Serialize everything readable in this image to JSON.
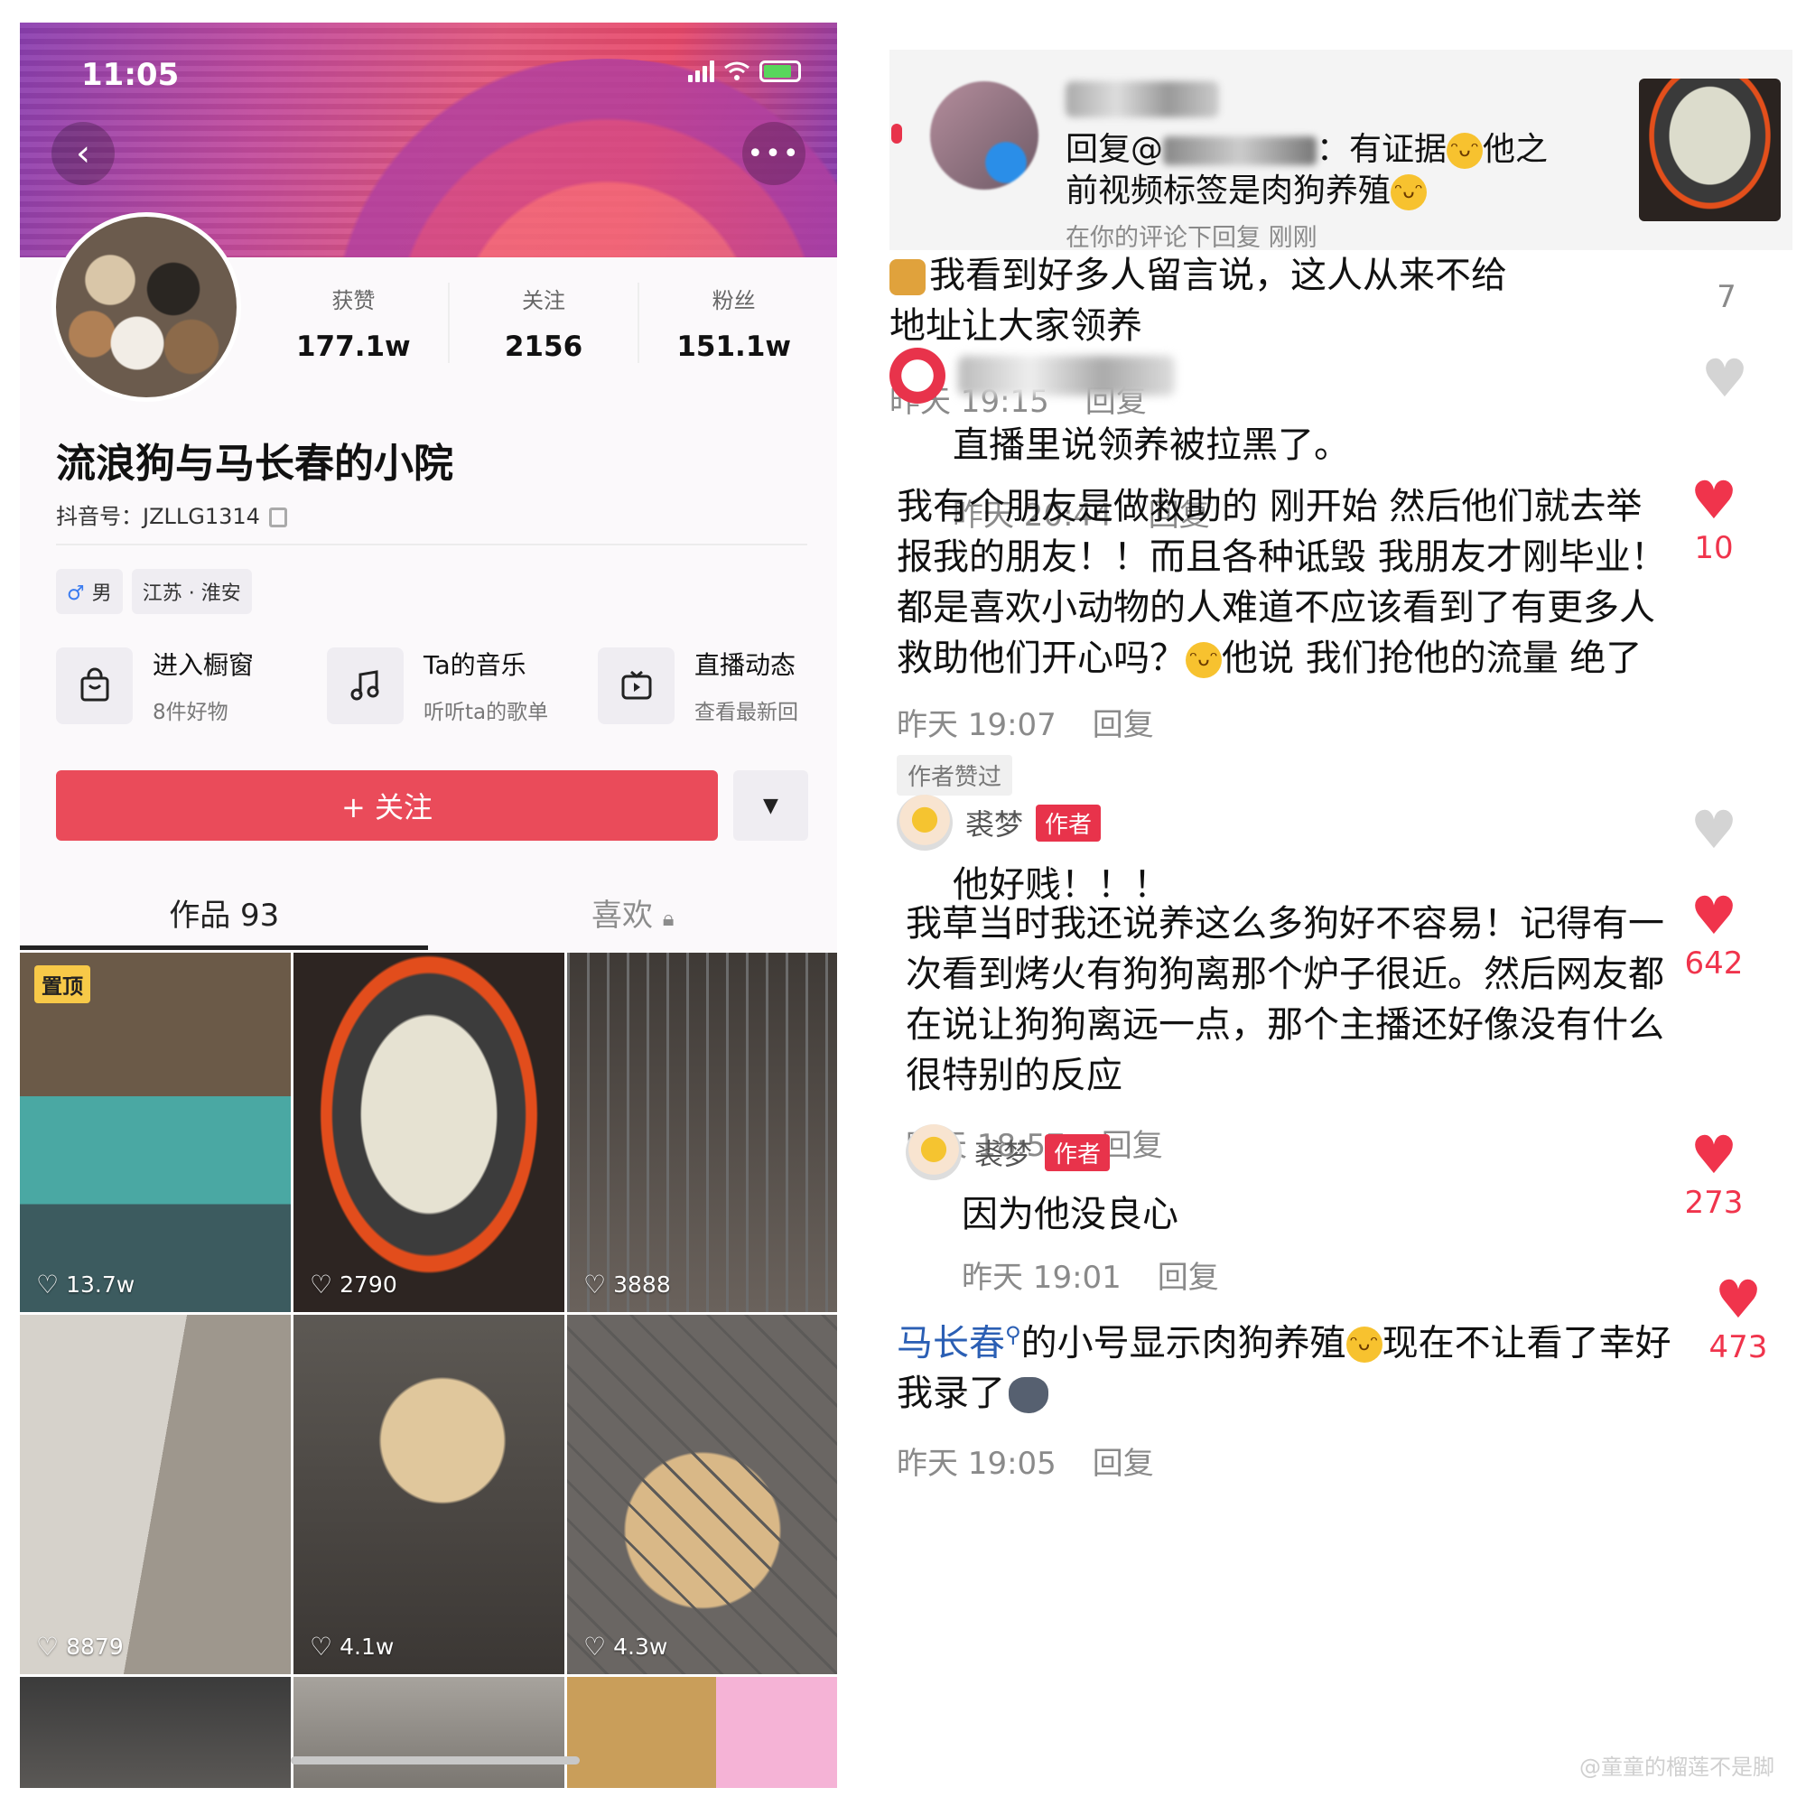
{
  "left": {
    "status_time": "11:05",
    "stats": [
      {
        "label": "获赞",
        "value": "177.1w"
      },
      {
        "label": "关注",
        "value": "2156"
      },
      {
        "label": "粉丝",
        "value": "151.1w"
      }
    ],
    "nickname": "流浪狗与马长春的小院",
    "douyin_id": "抖音号：JZLLG1314",
    "tags": {
      "gender_symbol": "♂",
      "gender": "男",
      "location": "江苏 · 淮安"
    },
    "shortcuts": [
      {
        "icon": "shop-bag-icon",
        "title": "进入橱窗",
        "sub": "8件好物"
      },
      {
        "icon": "music-note-icon",
        "title": "Ta的音乐",
        "sub": "听听ta的歌单"
      },
      {
        "icon": "live-tv-icon",
        "title": "直播动态",
        "sub": "查看最新回"
      }
    ],
    "follow_label": "+ 关注",
    "tabs": {
      "works": "作品 93",
      "likes": "喜欢"
    },
    "pinned_label": "置顶",
    "videos": [
      {
        "likes": "13.7w"
      },
      {
        "likes": "2790"
      },
      {
        "likes": "3888"
      },
      {
        "likes": "8879"
      },
      {
        "likes": "4.1w"
      },
      {
        "likes": "4.3w"
      },
      {
        "likes": ""
      },
      {
        "likes": ""
      },
      {
        "likes": ""
      }
    ]
  },
  "right": {
    "notice": {
      "line1_prefix": "回复@",
      "line1_suffix": "：有证据",
      "line1_end": "他之",
      "line2": "前视频标签是肉狗养殖",
      "meta": "在你的评论下回复  刚刚"
    },
    "comments": [
      {
        "text": "我看到好多人留言说，这人从来不给地址让大家领养",
        "time": "昨天 19:15",
        "reply": "回复",
        "likes": "7"
      },
      {
        "text": "直播里说领养被拉黑了。",
        "time": "昨天 20:44",
        "reply": "回复",
        "likes": ""
      },
      {
        "text_a": "我有个朋友是做救助的 刚开始 然后他们就去举报我的朋友！！而且各种诋毁 我朋友才刚毕业！都是喜欢小动物的人难道不应该看到了有更多人救助他们开心吗？",
        "text_b": "他说 我们抢他的流量 绝了",
        "time": "昨天 19:07",
        "reply": "回复",
        "likes": "10",
        "author_liked": "作者赞过"
      },
      {
        "name": "裘梦",
        "badge": "作者",
        "text": "他好贱！！！",
        "likes": ""
      },
      {
        "text": "我草当时我还说养这么多狗好不容易！记得有一次看到烤火有狗狗离那个炉子很近。然后网友都在说让狗狗离远一点，那个主播还好像没有什么很特别的反应",
        "time": "昨天 18:57",
        "reply": "回复",
        "likes": "642"
      },
      {
        "name": "裘梦",
        "badge": "作者",
        "text": "因为他没良心",
        "time": "昨天 19:01",
        "reply": "回复",
        "likes": "273"
      },
      {
        "mention": "马长春",
        "text_a": "的小号显示肉狗养殖",
        "text_b": "现在不让看了幸好我录了",
        "time": "昨天 19:05",
        "reply": "回复",
        "likes": "473"
      }
    ],
    "watermark": "@童童的榴莲不是脚"
  },
  "colors": {
    "accent_red": "#ea4b5a",
    "like_red": "#f0344c",
    "mention_blue": "#2b5fb4"
  }
}
